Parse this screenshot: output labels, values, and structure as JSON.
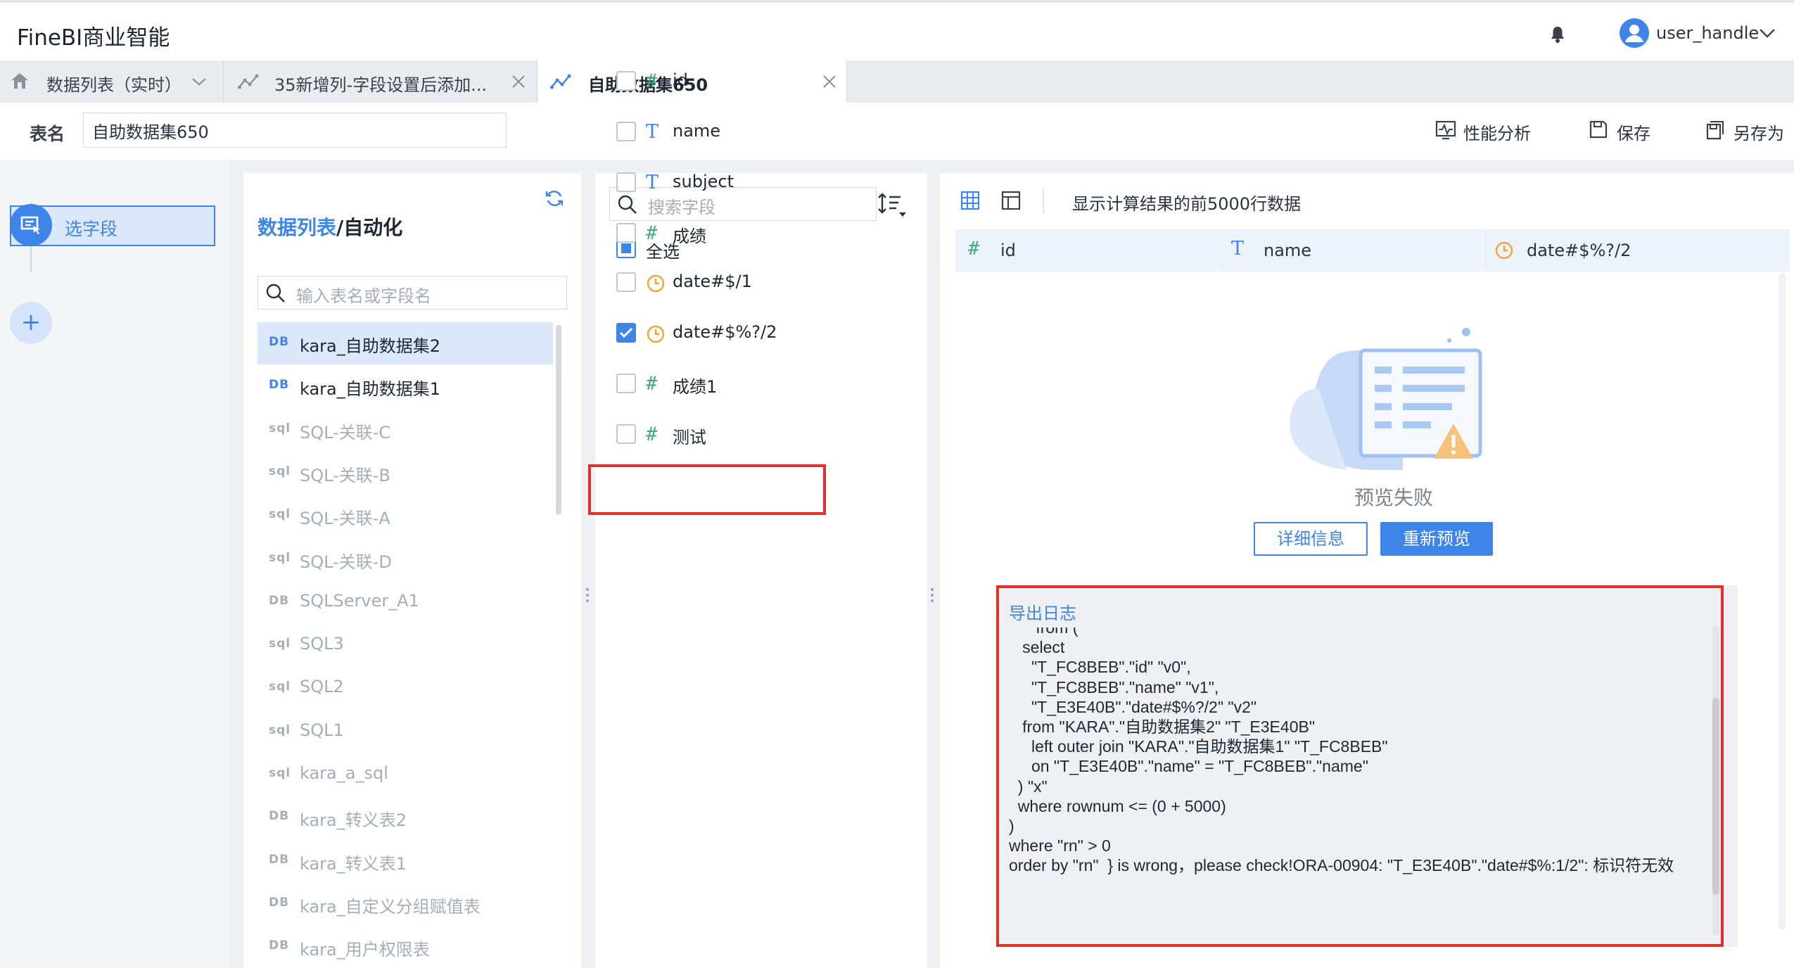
{
  "app": {
    "title": "FineBI商业智能",
    "username": "user_handle"
  },
  "tabs": [
    {
      "label": "数据列表（实时）",
      "icon": "home-icon",
      "closable": false,
      "active": false
    },
    {
      "label": "35新增列-字段设置后添加...",
      "icon": "dataset-icon",
      "closable": true,
      "active": false
    },
    {
      "label": "自助数据集650",
      "icon": "dataset-icon",
      "closable": true,
      "active": true
    }
  ],
  "namebar": {
    "label": "表名",
    "value": "自助数据集650",
    "actions": [
      "性能分析",
      "保存",
      "另存为"
    ]
  },
  "steps": {
    "select_field_label": "选字段",
    "add_label": "+"
  },
  "table_panel": {
    "breadcrumb_root": "数据列表",
    "breadcrumb_sep": "/",
    "breadcrumb_leaf": "自动化",
    "search_placeholder": "输入表名或字段名",
    "tables": [
      {
        "tag": "DB",
        "name": "kara_自助数据集2",
        "enabled": true,
        "selected": true
      },
      {
        "tag": "DB",
        "name": "kara_自助数据集1",
        "enabled": true,
        "selected": false
      },
      {
        "tag": "sql",
        "name": "SQL-关联-C",
        "enabled": false,
        "selected": false
      },
      {
        "tag": "sql",
        "name": "SQL-关联-B",
        "enabled": false,
        "selected": false
      },
      {
        "tag": "sql",
        "name": "SQL-关联-A",
        "enabled": false,
        "selected": false
      },
      {
        "tag": "sql",
        "name": "SQL-关联-D",
        "enabled": false,
        "selected": false
      },
      {
        "tag": "DB",
        "name": "SQLServer_A1",
        "enabled": false,
        "selected": false
      },
      {
        "tag": "sql",
        "name": "SQL3",
        "enabled": false,
        "selected": false
      },
      {
        "tag": "sql",
        "name": "SQL2",
        "enabled": false,
        "selected": false
      },
      {
        "tag": "sql",
        "name": "SQL1",
        "enabled": false,
        "selected": false
      },
      {
        "tag": "sql",
        "name": "kara_a_sql",
        "enabled": false,
        "selected": false
      },
      {
        "tag": "DB",
        "name": "kara_转义表2",
        "enabled": false,
        "selected": false
      },
      {
        "tag": "DB",
        "name": "kara_转义表1",
        "enabled": false,
        "selected": false
      },
      {
        "tag": "DB",
        "name": "kara_自定义分组赋值表",
        "enabled": false,
        "selected": false
      },
      {
        "tag": "DB",
        "name": "kara_用户权限表",
        "enabled": false,
        "selected": false
      }
    ]
  },
  "field_panel": {
    "search_placeholder": "搜索字段",
    "select_all_label": "全选",
    "fields": [
      {
        "type": "number",
        "name": "id",
        "checked": false
      },
      {
        "type": "text",
        "name": "name",
        "checked": false
      },
      {
        "type": "text",
        "name": "subject",
        "checked": false
      },
      {
        "type": "number",
        "name": "成绩",
        "checked": false
      },
      {
        "type": "date",
        "name": "date#$/1",
        "checked": false
      },
      {
        "type": "date",
        "name": "date#$%?/2",
        "checked": true
      },
      {
        "type": "number",
        "name": "成绩1",
        "checked": false
      },
      {
        "type": "number",
        "name": "测试",
        "checked": false
      }
    ]
  },
  "preview": {
    "info": "显示计算结果的前5000行数据",
    "columns": [
      {
        "type": "number",
        "name": "id"
      },
      {
        "type": "text",
        "name": "name"
      },
      {
        "type": "date",
        "name": "date#$%?/2"
      }
    ],
    "fail_text": "预览失败",
    "detail_button": "详细信息",
    "retry_button": "重新预览",
    "log_title": "导出日志",
    "log_text": "      from (\n   select\n     \"T_FC8BEB\".\"id\" \"v0\",\n     \"T_FC8BEB\".\"name\" \"v1\",\n     \"T_E3E40B\".\"date#$%?/2\" \"v2\"\n   from \"KARA\".\"自助数据集2\" \"T_E3E40B\"\n     left outer join \"KARA\".\"自助数据集1\" \"T_FC8BEB\"\n     on \"T_E3E40B\".\"name\" = \"T_FC8BEB\".\"name\"\n  ) \"x\"\n  where rownum <= (0 + 5000)\n)\nwhere \"rn\" > 0\norder by \"rn\"  } is wrong，please check!ORA-00904: \"T_E3E40B\".\"date#$%:1/2\": 标识符无效"
  },
  "colors": {
    "accent": "#3d85e8",
    "highlight_box": "#e1302b",
    "number_type": "#3fae7a",
    "date_type": "#f0a336"
  }
}
